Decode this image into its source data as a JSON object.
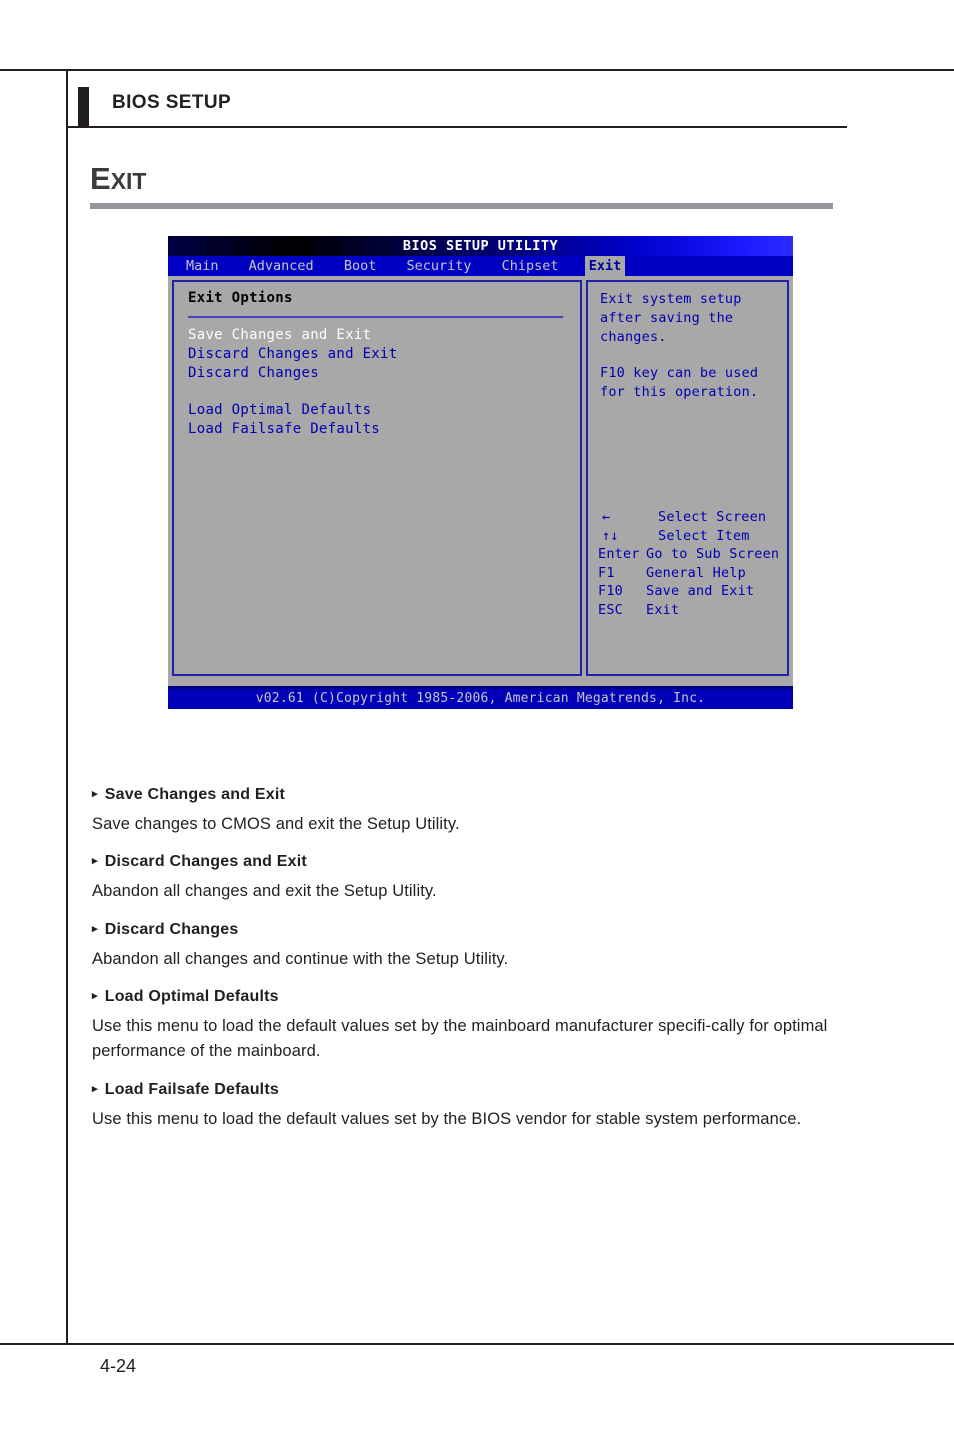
{
  "page": {
    "chapter_title": "BIOS SETUP",
    "section_title_cap": "E",
    "section_title_rest": "XIT",
    "page_number": "4-24"
  },
  "bios": {
    "title": "BIOS SETUP UTILITY",
    "menu": [
      {
        "label": "Main",
        "active": false
      },
      {
        "label": "Advanced",
        "active": false
      },
      {
        "label": "Boot",
        "active": false
      },
      {
        "label": "Security",
        "active": false
      },
      {
        "label": "Chipset",
        "active": false
      },
      {
        "label": "Exit",
        "active": true
      }
    ],
    "left_panel": {
      "heading": "Exit Options",
      "options": [
        {
          "label": "Save Changes and Exit",
          "selected": true
        },
        {
          "label": "Discard Changes and Exit",
          "selected": false
        },
        {
          "label": "Discard Changes",
          "selected": false
        },
        {
          "label": "Load Optimal Defaults",
          "selected": false
        },
        {
          "label": "Load Failsafe Defaults",
          "selected": false
        }
      ]
    },
    "right_panel": {
      "help_line_1": "Exit system setup",
      "help_line_2": "after saving the",
      "help_line_3": "changes.",
      "help_line_4": "F10 key can be used",
      "help_line_5": "for this operation.",
      "keys": [
        {
          "key": "←",
          "desc": "Select Screen",
          "symbol": true
        },
        {
          "key": "↑↓",
          "desc": "Select Item",
          "symbol": true
        },
        {
          "key": "Enter",
          "desc": "Go to Sub Screen",
          "symbol": false
        },
        {
          "key": "F1",
          "desc": "General Help",
          "symbol": false
        },
        {
          "key": "F10",
          "desc": "Save and Exit",
          "symbol": false
        },
        {
          "key": "ESC",
          "desc": "Exit",
          "symbol": false
        }
      ]
    },
    "footer": "v02.61 (C)Copyright 1985-2006, American Megatrends, Inc."
  },
  "descriptions": [
    {
      "bullet": "▸",
      "heading": "Save Changes and Exit",
      "body": "Save changes to CMOS and exit the Setup Utility."
    },
    {
      "bullet": "▸",
      "heading": "Discard Changes and Exit",
      "body": "Abandon all changes and exit the Setup Utility."
    },
    {
      "bullet": "▸",
      "heading": "Discard Changes",
      "body": "Abandon all changes and continue with the Setup Utility."
    },
    {
      "bullet": "▸",
      "heading": "Load Optimal Defaults",
      "body": "Use this menu to load the default values set by the mainboard manufacturer specifi-cally for optimal performance of the mainboard."
    },
    {
      "bullet": "▸",
      "heading": "Load Failsafe Defaults",
      "body": "Use this menu to load the default values set by the BIOS vendor for stable system performance."
    }
  ],
  "colors": {
    "bios_blue": "#0000b0",
    "bios_gray": "#a8a8a8",
    "menu_bar": "#0000c4",
    "rule_gray": "#939598",
    "ink": "#231f20"
  }
}
